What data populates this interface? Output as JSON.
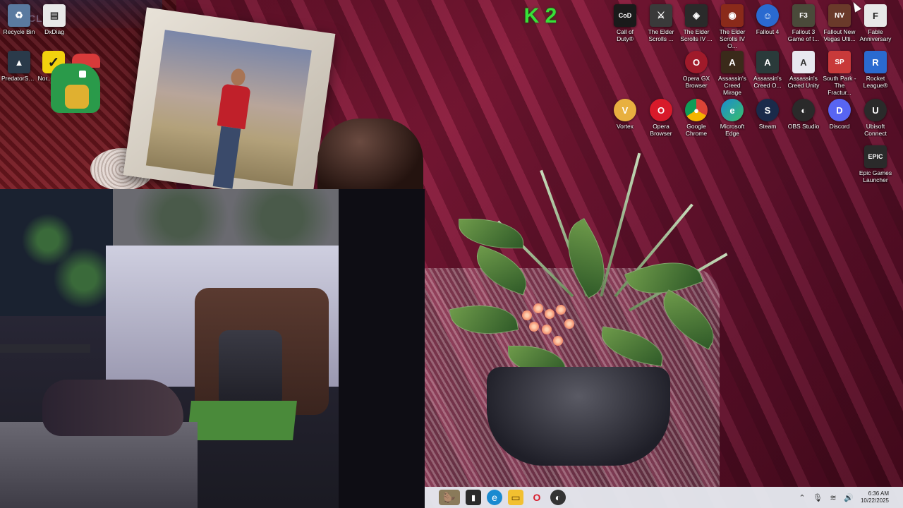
{
  "desktop": {
    "left_icons": [
      {
        "label": "Recycle Bin",
        "icon": "recycle-bin-icon",
        "color": "#5a7aa0"
      },
      {
        "label": "DxDiag",
        "icon": "dxdiag-icon",
        "color": "#e8e8e8"
      },
      {
        "label": "PredatorSe...",
        "icon": "predator-sense-icon",
        "color": "#2a3a4a"
      },
      {
        "label": "Nor...Secu...",
        "icon": "norton-icon",
        "color": "#f2d20e"
      }
    ],
    "right_icons_row1": [
      {
        "label": "Call of Duty®",
        "glyph": "CoD",
        "color": "#1a1a1a"
      },
      {
        "label": "The Elder Scrolls ...",
        "glyph": "⚔",
        "color": "#3a3a3a"
      },
      {
        "label": "The Elder Scrolls IV ...",
        "glyph": "◈",
        "color": "#2a2a2a"
      },
      {
        "label": "The Elder Scrolls IV O...",
        "glyph": "◉",
        "color": "#8a2a1a"
      },
      {
        "label": "Fallout 4",
        "glyph": "☺",
        "color": "#2a6ad0"
      },
      {
        "label": "Fallout 3 Game of t...",
        "glyph": "F3",
        "color": "#4a4a3a"
      },
      {
        "label": "Fallout New Vegas Ulti...",
        "glyph": "NV",
        "color": "#6a3a2a"
      },
      {
        "label": "Fable Anniversary",
        "glyph": "F",
        "color": "#e8e8e8"
      }
    ],
    "right_icons_row2": [
      {
        "label": "Opera GX Browser",
        "glyph": "O",
        "color": "#a01a2a"
      },
      {
        "label": "Assassin's Creed Mirage",
        "glyph": "A",
        "color": "#3a2a1a"
      },
      {
        "label": "Assassin's Creed O...",
        "glyph": "A",
        "color": "#2a3a3a"
      },
      {
        "label": "Assassin's Creed Unity",
        "glyph": "A",
        "color": "#e8e8f0"
      },
      {
        "label": "South Park - The Fractur...",
        "glyph": "SP",
        "color": "#c83a3a"
      },
      {
        "label": "Rocket League®",
        "glyph": "R",
        "color": "#2a6ad0"
      }
    ],
    "right_icons_row3": [
      {
        "label": "Vortex",
        "glyph": "V",
        "color": "#e8b040"
      },
      {
        "label": "Opera Browser",
        "glyph": "O",
        "color": "#d81a2a"
      },
      {
        "label": "Google Chrome",
        "glyph": "◎",
        "color": "#e0a020"
      },
      {
        "label": "Microsoft Edge",
        "glyph": "e",
        "color": "#1a8ad0"
      },
      {
        "label": "Steam",
        "glyph": "S",
        "color": "#1a2a4a"
      },
      {
        "label": "OBS Studio",
        "glyph": "◐",
        "color": "#2a2a2a"
      },
      {
        "label": "Discord",
        "glyph": "D",
        "color": "#5865f2"
      },
      {
        "label": "Ubisoft Connect",
        "glyph": "U",
        "color": "#2a2a2a"
      }
    ],
    "right_icons_row4": [
      {
        "label": "Epic Games Launcher",
        "glyph": "EPIC",
        "color": "#2a2a2a"
      }
    ]
  },
  "overlay": {
    "k2_text": "K 2"
  },
  "taskbar": {
    "clock_time": "6:36 AM",
    "clock_date": "10/22/2025"
  }
}
